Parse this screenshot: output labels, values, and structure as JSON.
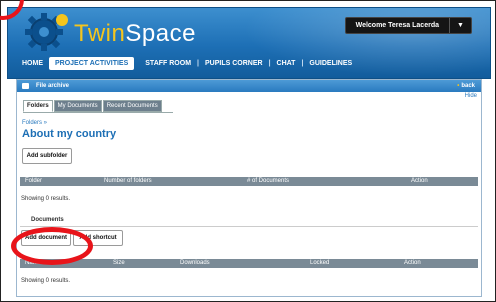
{
  "header": {
    "logo_text_twin": "Twin",
    "logo_text_space": "Space",
    "welcome": "Welcome Teresa Lacerda",
    "welcome_caret": "▼"
  },
  "nav": {
    "home": "HOME",
    "items": [
      "PROJECT ACTIVITIES",
      "STAFF ROOM",
      "PUPILS CORNER",
      "CHAT",
      "GUIDELINES"
    ],
    "separator": "|"
  },
  "panel": {
    "title": "File archive",
    "back": "back",
    "back_dot": "•",
    "hide": "Hide",
    "tabs": [
      "Folders",
      "My Documents",
      "Recent Documents"
    ]
  },
  "breadcrumb": "Folders »",
  "page_title": "About my country",
  "add_subfolder": "Add subfolder",
  "folders_table": {
    "columns": [
      "Folder",
      "Number of folders",
      "# of Documents",
      "Action"
    ],
    "empty": "Showing 0 results."
  },
  "documents": {
    "label": "Documents",
    "add_document": "Add document",
    "add_shortcut": "Add shortcut"
  },
  "documents_table": {
    "columns": [
      "Name",
      "Size",
      "Downloads",
      "Locked",
      "Action"
    ],
    "empty": "Showing 0 results."
  },
  "colors": {
    "header_blue": "#1d6fb5",
    "annotation_red": "#e8141a",
    "logo_yellow": "#f4c51d",
    "table_header": "#7a8a96"
  },
  "icons": [
    "gear-logo-icon",
    "folder-icon"
  ]
}
